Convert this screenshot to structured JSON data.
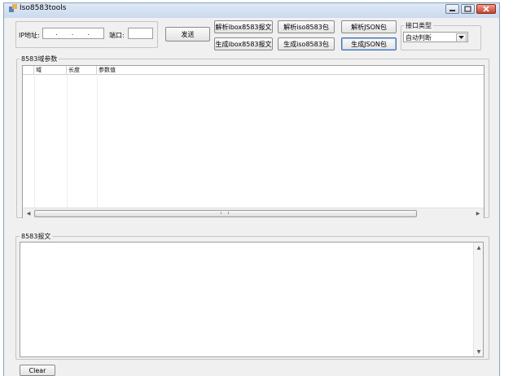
{
  "window": {
    "title": "Iso8583tools"
  },
  "conn": {
    "ip_label": "IP地址:",
    "ip_value": "  .  .  .",
    "port_label": "端口:",
    "send_label": "发送"
  },
  "buttons": {
    "parse_ibox": "解析ibox8583报文",
    "gen_ibox": "生成ibox8583报文",
    "parse_iso": "解析iso8583包",
    "gen_iso": "生成iso8583包",
    "parse_json": "解析JSON包",
    "gen_json": "生成JSON包"
  },
  "iface": {
    "legend": "接口类型",
    "selected": "自动判断"
  },
  "fields": {
    "legend": "8583域参数",
    "columns": [
      "域",
      "长度",
      "参数值"
    ],
    "rows": []
  },
  "message": {
    "legend": "8583报文",
    "text": ""
  },
  "clear_label": "Clear"
}
